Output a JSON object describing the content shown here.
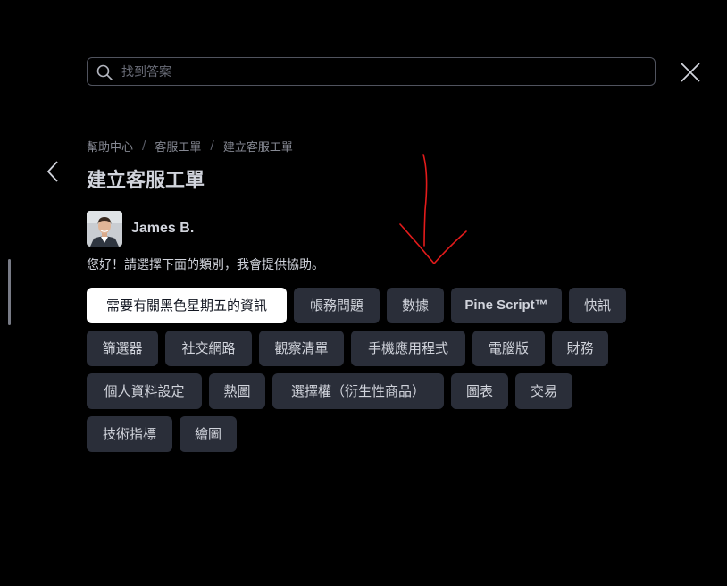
{
  "search": {
    "placeholder": "找到答案"
  },
  "breadcrumb": [
    {
      "label": "幫助中心"
    },
    {
      "label": "客服工單"
    },
    {
      "label": "建立客服工單"
    }
  ],
  "breadcrumb_separator": "/",
  "page": {
    "title": "建立客服工單"
  },
  "agent": {
    "name": "James B.",
    "greeting": "您好！請選擇下面的類別，我會提供協助。"
  },
  "categories": [
    {
      "label": "需要有關黑色星期五的資訊",
      "selected": true
    },
    {
      "label": "帳務問題"
    },
    {
      "label": "數據"
    },
    {
      "label": "Pine Script™"
    },
    {
      "label": "快訊"
    },
    {
      "label": "篩選器"
    },
    {
      "label": "社交網路"
    },
    {
      "label": "觀察清單"
    },
    {
      "label": "手機應用程式"
    },
    {
      "label": "電腦版"
    },
    {
      "label": "財務"
    },
    {
      "label": "個人資料設定"
    },
    {
      "label": "熱圖"
    },
    {
      "label": "選擇權（衍生性商品）"
    },
    {
      "label": "圖表"
    },
    {
      "label": "交易"
    },
    {
      "label": "技術指標"
    },
    {
      "label": "繪圖"
    }
  ],
  "icons": {
    "search": "search-icon",
    "close": "close-icon",
    "back": "chevron-left-icon",
    "annotation": "arrow-down-annotation"
  },
  "colors": {
    "background": "#000000",
    "chip_bg": "#2a2e39",
    "chip_selected_bg": "#ffffff",
    "text": "#d1d4dc",
    "muted_text": "#868993",
    "annotation": "#e31b1b"
  }
}
